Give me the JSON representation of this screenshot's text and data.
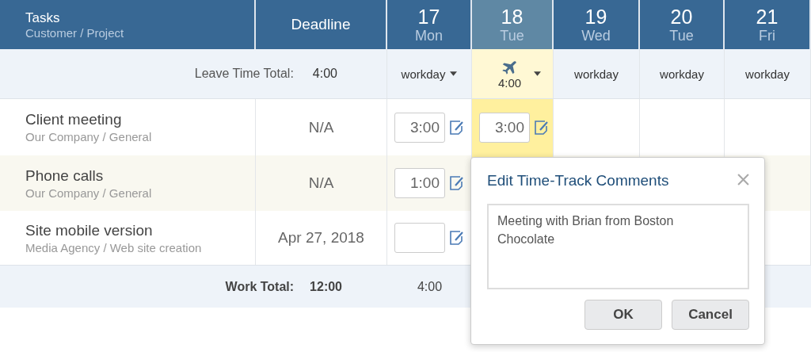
{
  "header": {
    "tasks": "Tasks",
    "tasks_sub": "Customer / Project",
    "deadline": "Deadline"
  },
  "days": [
    {
      "number": "17",
      "weekday": "Mon",
      "selected": false,
      "leave": {
        "kind": "dropdown",
        "label": "workday"
      }
    },
    {
      "number": "18",
      "weekday": "Tue",
      "selected": true,
      "leave": {
        "kind": "leave",
        "label": "4:00"
      }
    },
    {
      "number": "19",
      "weekday": "Wed",
      "selected": false,
      "leave": {
        "kind": "plain",
        "label": "workday"
      }
    },
    {
      "number": "20",
      "weekday": "Tue",
      "selected": false,
      "leave": {
        "kind": "plain",
        "label": "workday"
      }
    },
    {
      "number": "21",
      "weekday": "Fri",
      "selected": false,
      "leave": {
        "kind": "plain",
        "label": "workday"
      }
    }
  ],
  "leave_total": {
    "label": "Leave Time Total:",
    "value": "4:00"
  },
  "rows": [
    {
      "task": "Client meeting",
      "project": "Our Company / General",
      "deadline": "N/A",
      "highlighted": false,
      "entries": [
        {
          "kind": "input",
          "value": "3:00"
        },
        {
          "kind": "input",
          "value": "3:00"
        },
        {
          "kind": "blank"
        },
        {
          "kind": "blank"
        },
        {
          "kind": "blank"
        }
      ]
    },
    {
      "task": "Phone calls",
      "project": "Our Company / General",
      "deadline": "N/A",
      "highlighted": true,
      "entries": [
        {
          "kind": "input",
          "value": "1:00"
        }
      ]
    },
    {
      "task": "Site mobile version",
      "project": "Media Agency / Web site creation",
      "deadline": "Apr 27, 2018",
      "highlighted": false,
      "entries": [
        {
          "kind": "input"
        }
      ]
    }
  ],
  "work_total": {
    "label": "Work Total:",
    "value": "12:00",
    "days": [
      "4:00"
    ]
  },
  "dialog": {
    "title": "Edit Time-Track Comments",
    "comment": "Meeting with Brian from Boston Chocolate",
    "buttons": [
      "OK",
      "Cancel"
    ]
  }
}
